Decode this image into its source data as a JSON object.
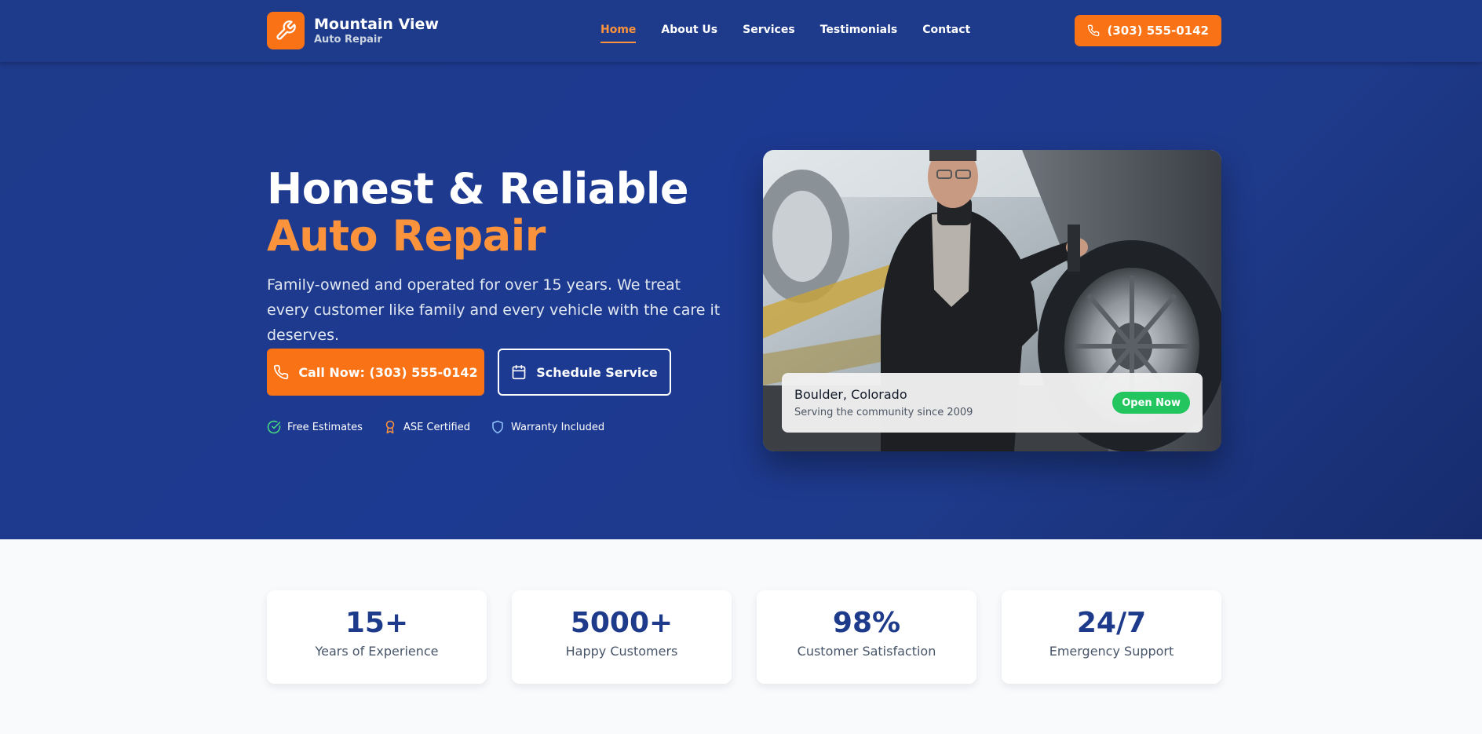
{
  "brand": {
    "name": "Mountain View",
    "tagline": "Auto Repair",
    "logo_icon": "wrench-icon"
  },
  "nav": {
    "items": [
      {
        "label": "Home",
        "active": true
      },
      {
        "label": "About Us",
        "active": false
      },
      {
        "label": "Services",
        "active": false
      },
      {
        "label": "Testimonials",
        "active": false
      },
      {
        "label": "Contact",
        "active": false
      }
    ],
    "phone": "(303) 555-0142",
    "phone_icon": "phone-icon"
  },
  "hero": {
    "title_line1": "Honest & Reliable",
    "title_line2": "Auto Repair",
    "description": "Family-owned and operated for over 15 years. We treat every customer like family and every vehicle with the care it deserves.",
    "cta_primary": "Call Now: (303) 555-0142",
    "cta_secondary": "Schedule Service",
    "badges": [
      {
        "label": "Free Estimates",
        "icon": "check-circle-icon"
      },
      {
        "label": "ASE Certified",
        "icon": "award-icon"
      },
      {
        "label": "Warranty Included",
        "icon": "shield-icon"
      }
    ],
    "location": {
      "title": "Boulder, Colorado",
      "subtitle": "Serving the community since 2009",
      "status": "Open Now"
    }
  },
  "stats": [
    {
      "value": "15+",
      "label": "Years of Experience"
    },
    {
      "value": "5000+",
      "label": "Happy Customers"
    },
    {
      "value": "98%",
      "label": "Customer Satisfaction"
    },
    {
      "value": "24/7",
      "label": "Emergency Support"
    }
  ],
  "colors": {
    "primary_navy": "#1e3a8a",
    "accent_orange": "#f97316",
    "accent_orange_light": "#fb923c",
    "status_green": "#22c55e"
  }
}
